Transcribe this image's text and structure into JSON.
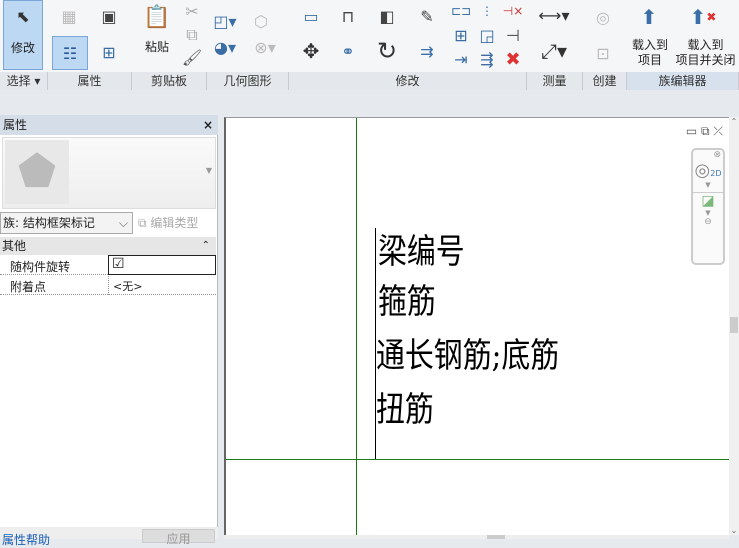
{
  "ribbon": {
    "modify_label": "修改",
    "paste_label": "粘贴",
    "load_project": [
      "载入到",
      "项目"
    ],
    "load_close": [
      "载入到",
      "项目并关闭"
    ],
    "panels": [
      "选择 ▾",
      "属性",
      "剪贴板",
      "几何图形",
      "修改",
      "测量",
      "创建",
      "族编辑器"
    ]
  },
  "properties": {
    "title": "属性",
    "close": "×",
    "type_selector": "族: 结构框架标记",
    "edit_type": "编辑类型",
    "group": "其他",
    "rows": [
      {
        "name": "随构件旋转",
        "value": "☑"
      },
      {
        "name": "附着点",
        "value": "<无>"
      }
    ],
    "help_link": "属性帮助",
    "apply": "应用"
  },
  "canvas": {
    "lines": [
      "梁编号",
      "箍筋",
      "通长钢筋;底筋",
      "扭筋"
    ]
  },
  "colors": {
    "accent": "#3a6ea5",
    "ref_line": "#1a7a1a",
    "selected": "#bcd8f2"
  }
}
